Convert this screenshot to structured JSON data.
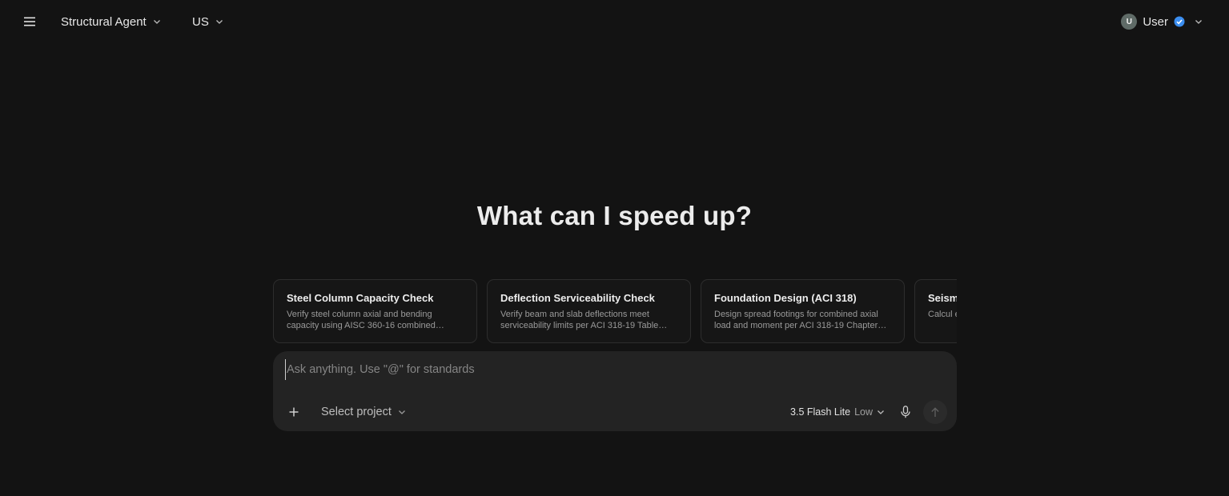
{
  "header": {
    "agent_label": "Structural Agent",
    "region_label": "US",
    "user_initial": "U",
    "user_name": "User"
  },
  "main": {
    "heading": "What can I speed up?"
  },
  "suggestions": [
    {
      "title": "Steel Column Capacity Check",
      "description": "Verify steel column axial and bending capacity using AISC 360-16 combined…"
    },
    {
      "title": "Deflection Serviceability Check",
      "description": "Verify beam and slab deflections meet serviceability limits per ACI 318-19 Table…"
    },
    {
      "title": "Foundation Design (ACI 318)",
      "description": "Design spread footings for combined axial load and moment per ACI 318-19 Chapter…"
    },
    {
      "title": "Seism",
      "description": "Calcul equiva"
    }
  ],
  "composer": {
    "placeholder": "Ask anything. Use \"@\" for standards",
    "value": "",
    "project_label": "Select project",
    "model_name": "3.5 Flash Lite",
    "model_level": "Low"
  },
  "colors": {
    "background": "#131313",
    "composer_bg": "#232323",
    "verified_badge": "#3b8ef0"
  }
}
